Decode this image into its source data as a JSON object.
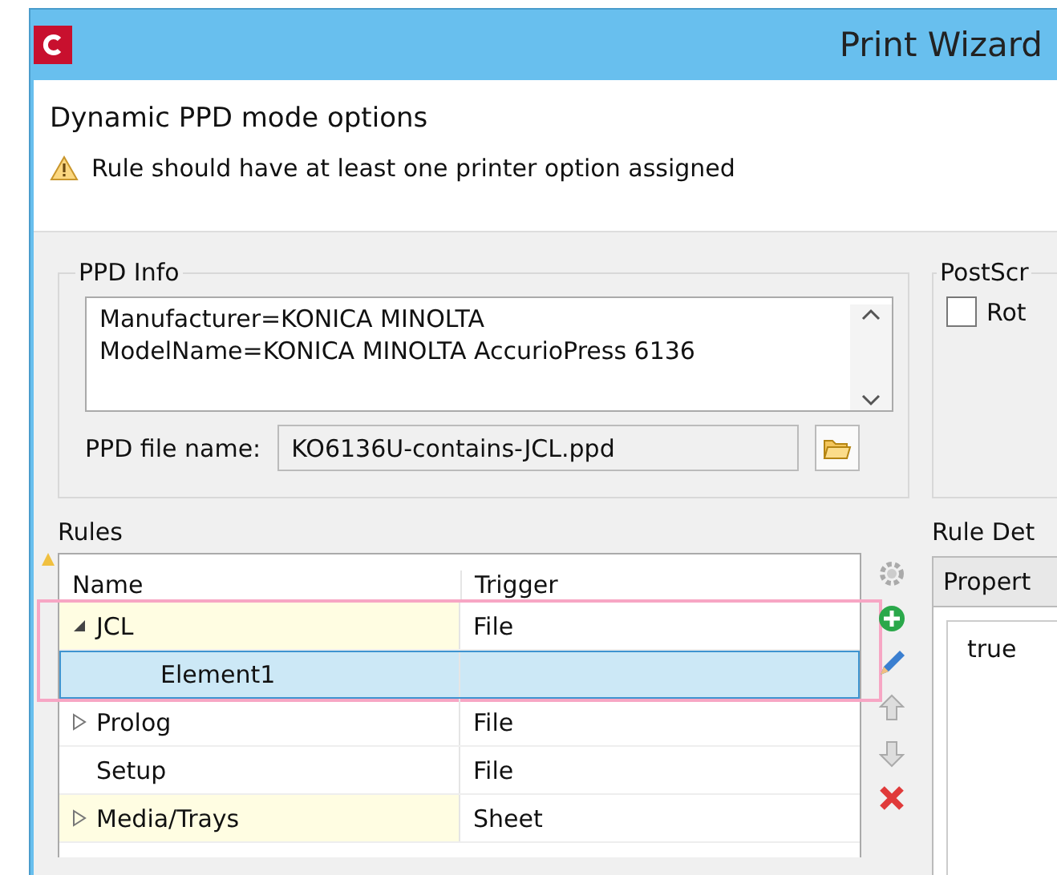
{
  "window": {
    "title": "Print Wizard"
  },
  "header": {
    "title": "Dynamic PPD mode options",
    "warning": "Rule should have at least one printer option assigned"
  },
  "ppd_info": {
    "label": "PPD Info",
    "lines": [
      "Manufacturer=KONICA MINOLTA",
      "ModelName=KONICA MINOLTA AccurioPress 6136"
    ],
    "file_label": "PPD file name:",
    "file_value": "KO6136U-contains-JCL.ppd"
  },
  "postscript": {
    "label": "PostScr",
    "checkbox": {
      "label": "Rot",
      "checked": false
    }
  },
  "rules": {
    "label": "Rules",
    "columns": [
      "Name",
      "Trigger"
    ],
    "rows": [
      {
        "name": "JCL",
        "trigger": "File",
        "marked": true,
        "expanded": true,
        "framed": true,
        "selected": false,
        "children": [
          {
            "name": "Element1",
            "marked": false,
            "framed": false,
            "selected": true
          }
        ]
      },
      {
        "name": "Prolog",
        "trigger": "File",
        "marked": false,
        "expanded": false,
        "framed": false,
        "selected": false,
        "children": []
      },
      {
        "name": "Setup",
        "trigger": "File",
        "marked": false,
        "framed": false,
        "selected": false
      },
      {
        "name": "Media/Trays",
        "trigger": "Sheet",
        "marked": true,
        "expanded": false,
        "framed": false,
        "selected": false,
        "children": []
      }
    ]
  },
  "rule_details": {
    "label": "Rule Det",
    "tab": "Propert",
    "value": "true"
  }
}
